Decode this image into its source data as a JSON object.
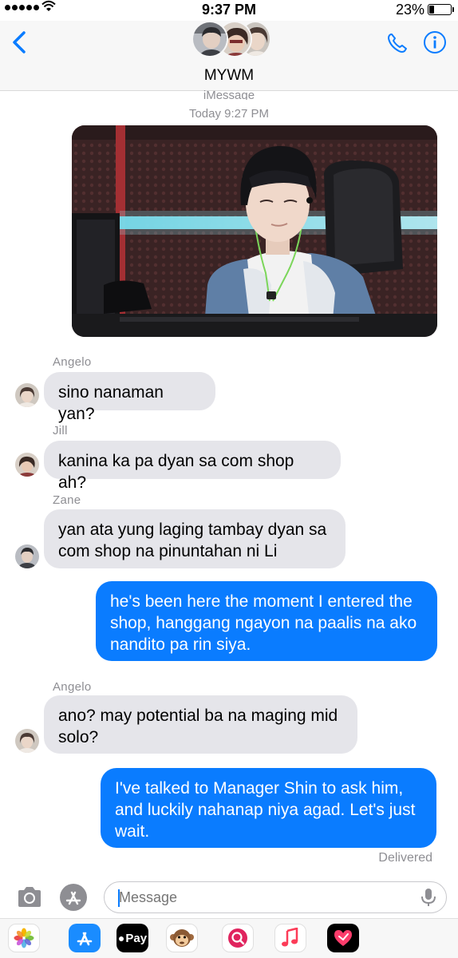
{
  "status_bar": {
    "time": "9:37 PM",
    "battery_percent": "23%",
    "battery_level": 0.23
  },
  "header": {
    "group_name": "MYWM"
  },
  "conversation": {
    "service_label": "iMessage",
    "timestamp": "Today 9:27 PM",
    "messages": [
      {
        "sender": "Angelo",
        "text": "sino nanaman yan?"
      },
      {
        "sender": "Jill",
        "text": "kanina ka pa dyan sa com shop ah?"
      },
      {
        "sender": "Zane",
        "text": "yan ata yung laging tambay dyan sa com shop na pinuntahan ni Li"
      },
      {
        "sender": "",
        "text": "he's been here the moment I entered the shop, hanggang ngayon na paalis na ako nandito pa rin siya."
      },
      {
        "sender": "Angelo",
        "text": "ano? may potential ba na maging mid solo?"
      },
      {
        "sender": "",
        "text": "I've talked to Manager Shin to ask him, and luckily nahanap niya agad. Let's just wait."
      }
    ],
    "delivery_status": "Delivered"
  },
  "composer": {
    "placeholder": "Message"
  },
  "app_strip": {
    "apple_pay_label": "Pay"
  },
  "colors": {
    "outgoing_bubble": "#0a7cff",
    "incoming_bubble": "#e5e5ea",
    "accent": "#0a7cff"
  }
}
